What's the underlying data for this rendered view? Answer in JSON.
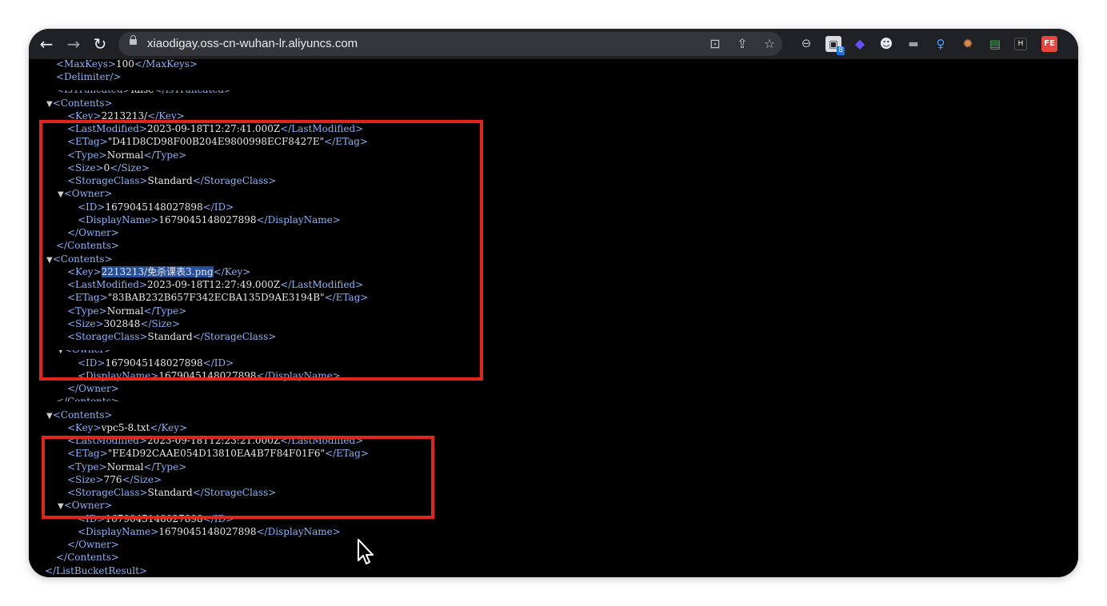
{
  "browser": {
    "url": "xiaodigay.oss-cn-wuhan-lr.aliyuncs.com",
    "extension_badges": [
      "8"
    ],
    "ext_letter_1": "FE"
  },
  "xml": {
    "max_keys": {
      "open": "<MaxKeys>",
      "value": "100",
      "close": "</MaxKeys>"
    },
    "delimiter": "<Delimiter/>",
    "is_truncated": {
      "open": "<IsTruncated>",
      "value": "false",
      "close": "</IsTruncated>"
    },
    "contents_open": "<Contents>",
    "contents_close": "</Contents>",
    "owner_open": "<Owner>",
    "owner_close": "</Owner>",
    "list_bucket_close": "</ListBucketResult>",
    "tags": {
      "key_o": "<Key>",
      "key_c": "</Key>",
      "lm_o": "<LastModified>",
      "lm_c": "</LastModified>",
      "etag_o": "<ETag>",
      "etag_c": "</ETag>",
      "type_o": "<Type>",
      "type_c": "</Type>",
      "size_o": "<Size>",
      "size_c": "</Size>",
      "sc_o": "<StorageClass>",
      "sc_c": "</StorageClass>",
      "id_o": "<ID>",
      "id_c": "</ID>",
      "dn_o": "<DisplayName>",
      "dn_c": "</DisplayName>"
    },
    "contents": [
      {
        "key": "2213213/",
        "last_modified": "2023-09-18T12:27:41.000Z",
        "etag": "\"D41D8CD98F00B204E9800998ECF8427E\"",
        "type": "Normal",
        "size": "0",
        "storage_class": "Standard",
        "owner_id": "1679045148027898",
        "owner_display_name": "1679045148027898"
      },
      {
        "key_selected": "2213213/免杀课表3.png",
        "last_modified": "2023-09-18T12:27:49.000Z",
        "etag": "\"83BAB232B657F342ECBA135D9AE3194B\"",
        "type": "Normal",
        "size": "302848",
        "storage_class": "Standard",
        "owner_id": "1679045148027898",
        "owner_display_name": "1679045148027898"
      },
      {
        "key": "vpc5-8.txt",
        "last_modified": "2023-09-18T12:23:21.000Z",
        "etag": "\"FE4D92CAAE054D13810EA4B7F84F01F6\"",
        "type": "Normal",
        "size": "776",
        "storage_class": "Standard",
        "owner_id": "1679045148027898",
        "owner_display_name": "1679045148027898"
      }
    ]
  },
  "colors": {
    "tag": "#8ab4f8",
    "highlight_box": "#e1251b",
    "selection": "#264f9a"
  }
}
